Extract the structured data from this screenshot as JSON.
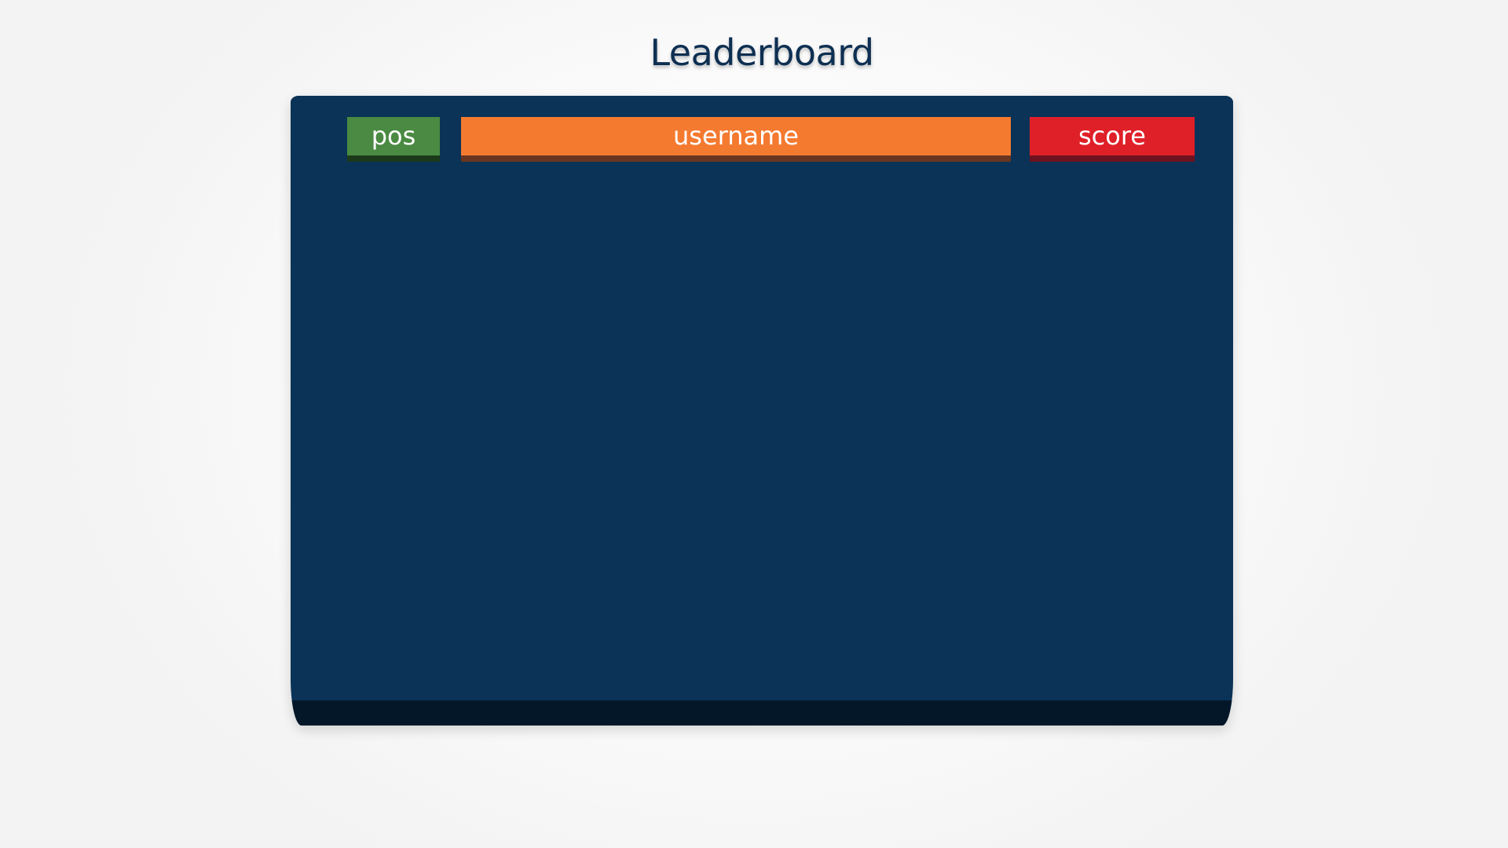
{
  "title": "Leaderboard",
  "columns": {
    "pos": "pos",
    "username": "username",
    "score": "score"
  },
  "colors": {
    "title": "#0d2f52",
    "board": "#0a3357",
    "pos_header": "#4a8a42",
    "username_header": "#f47a30",
    "score_header": "#df2028"
  },
  "rows": []
}
